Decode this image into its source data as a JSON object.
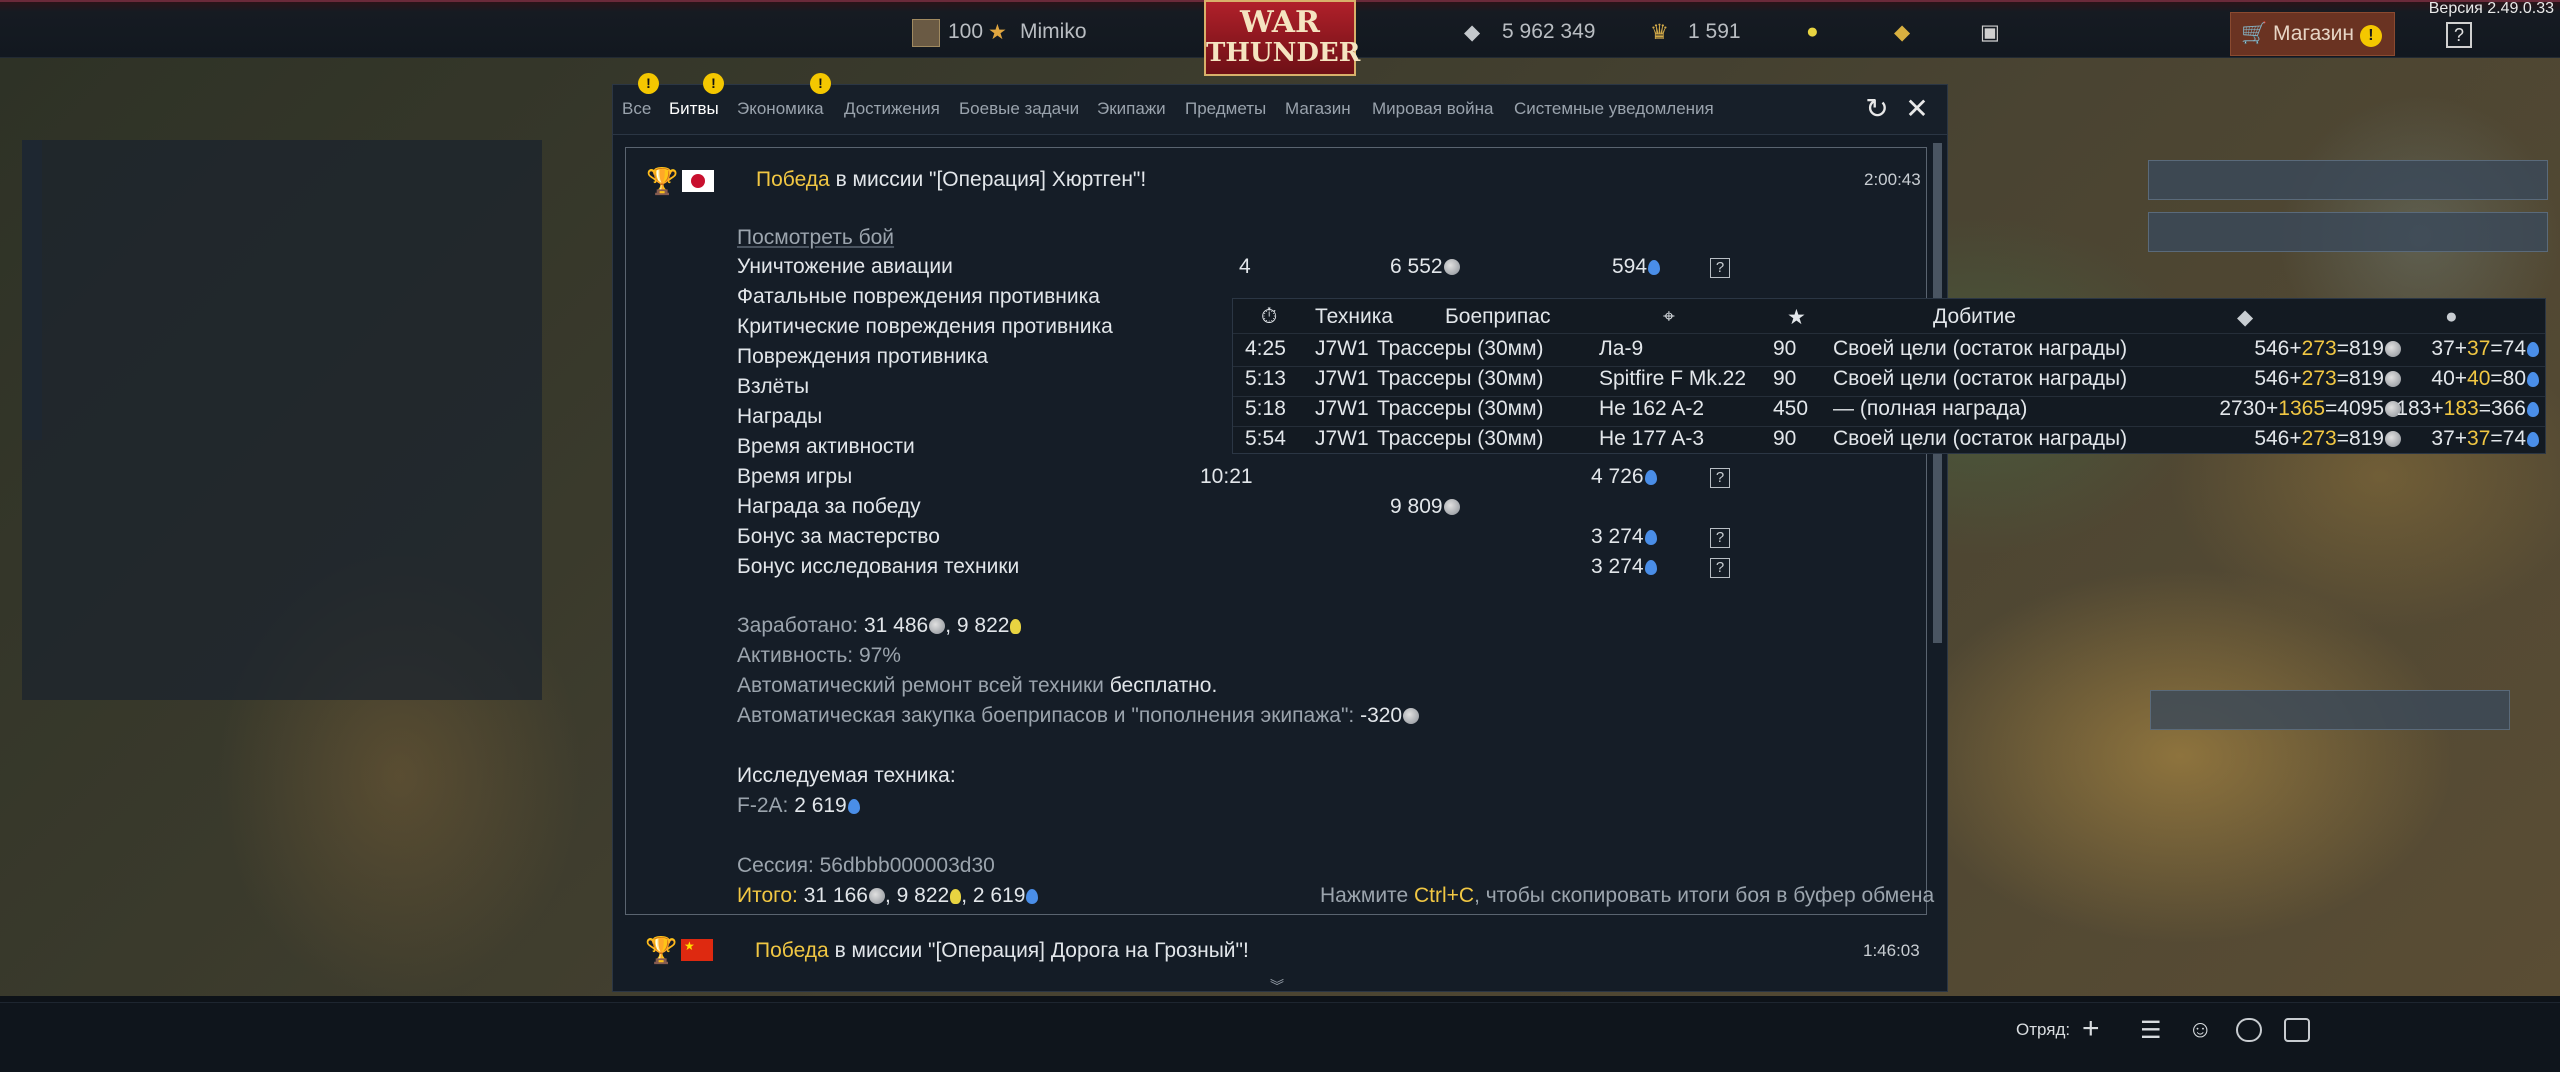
{
  "top_bar": {
    "version": "Версия 2.49.0.33",
    "player_level": "100",
    "player_name": "Mimiko",
    "logo_line1": "WAR",
    "logo_line2": "THUNDER",
    "silver_lions": "5 962 349",
    "golden_eagles": "1 591",
    "shop_label": "Магазин",
    "help_label": "?"
  },
  "tabs": [
    "Все",
    "Битвы",
    "Экономика",
    "Достижения",
    "Боевые задачи",
    "Экипажи",
    "Предметы",
    "Магазин",
    "Мировая война",
    "Системные уведомления"
  ],
  "tab_badges": [
    "!",
    "!",
    "!"
  ],
  "report": {
    "victory_word": "Победа",
    "mission_text": "в миссии \"[Операция] Хюртген\"!",
    "time": "2:00:43",
    "watch_battle": "Посмотреть бой",
    "rows": [
      {
        "label": "Уничтожение авиации",
        "count": "4",
        "silver": "6 552",
        "rp": "594"
      },
      {
        "label": "Фатальные повреждения противника"
      },
      {
        "label": "Критические повреждения противника"
      },
      {
        "label": "Повреждения противника"
      },
      {
        "label": "Взлёты"
      },
      {
        "label": "Награды"
      },
      {
        "label": "Время активности"
      },
      {
        "label": "Время игры",
        "count": "10:21",
        "rp": "4 726"
      },
      {
        "label": "Награда за победу",
        "silver": "9 809"
      },
      {
        "label": "Бонус за мастерство",
        "rp": "3 274"
      },
      {
        "label": "Бонус исследования техники",
        "rp": "3 274"
      }
    ],
    "earned_label": "Заработано:",
    "earned_silver": "31 486",
    "earned_rp": "9 822",
    "activity": "Активность: 97%",
    "repair_label": "Автоматический ремонт всей техники",
    "repair_value": "бесплатно.",
    "restock_label": "Автоматическая закупка боеприпасов и \"пополнения экипажа\":",
    "restock_value": "-320",
    "research_label": "Исследуемая техника:",
    "research_vehicle": "F-2A:",
    "research_value": "2 619",
    "session": "Сессия: 56dbbb000003d30",
    "total_label": "Итого:",
    "total_silver": "31 166",
    "total_rp": "9 822",
    "total_research": "2 619",
    "copy_hint_pre": "Нажмите",
    "copy_hint_key": "Ctrl+C",
    "copy_hint_post": ", чтобы скопировать итоги боя в буфер обмена"
  },
  "next_report": {
    "victory_word": "Победа",
    "mission_text": "в миссии \"[Операция] Дорога на Грозный\"!",
    "time": "1:46:03"
  },
  "tooltip": {
    "headers": {
      "vehicle": "Техника",
      "ammo": "Боеприпас",
      "finishing": "Добитие"
    },
    "rows": [
      {
        "time": "4:25",
        "vehicle": "J7W1",
        "ammo": "Трассеры (30мм)",
        "target": "Ла-9",
        "points": "90",
        "finish": "Своей цели (остаток награды)",
        "s1": "546",
        "s2": "273",
        "s3": "819",
        "r1": "37",
        "r2": "37",
        "r3": "74"
      },
      {
        "time": "5:13",
        "vehicle": "J7W1",
        "ammo": "Трассеры (30мм)",
        "target": "Spitfire F Mk.22",
        "points": "90",
        "finish": "Своей цели (остаток награды)",
        "s1": "546",
        "s2": "273",
        "s3": "819",
        "r1": "40",
        "r2": "40",
        "r3": "80"
      },
      {
        "time": "5:18",
        "vehicle": "J7W1",
        "ammo": "Трассеры (30мм)",
        "target": "He 162 A-2",
        "points": "450",
        "finish": "— (полная награда)",
        "s1": "2730",
        "s2": "1365",
        "s3": "4095",
        "r1": "183",
        "r2": "183",
        "r3": "366"
      },
      {
        "time": "5:54",
        "vehicle": "J7W1",
        "ammo": "Трассеры (30мм)",
        "target": "He 177 A-3",
        "points": "90",
        "finish": "Своей цели (остаток награды)",
        "s1": "546",
        "s2": "273",
        "s3": "819",
        "r1": "37",
        "r2": "37",
        "r3": "74"
      }
    ]
  },
  "bottom_bar": {
    "squad_label": "Отряд:"
  },
  "colors": {
    "accent_gold": "#f1c743",
    "rp_blue": "#4a8ee8",
    "shop_bg": "#6a3322",
    "logo_red": "#b0202a"
  }
}
